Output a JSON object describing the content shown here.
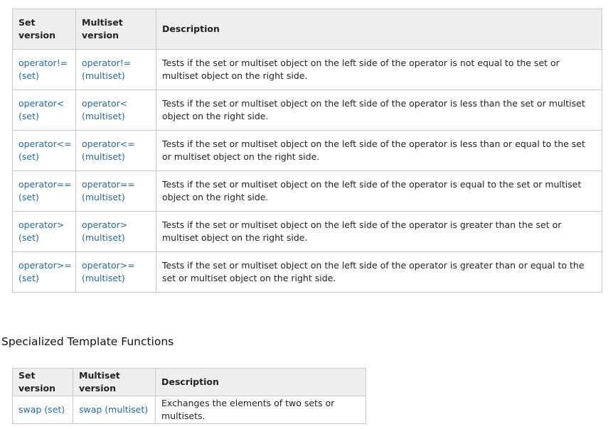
{
  "comparison_table": {
    "headers": [
      "Set version",
      "Multiset version",
      "Description"
    ],
    "rows": [
      {
        "set_l1": "operator!=",
        "set_l2": "(set)",
        "multi_l1": "operator!=",
        "multi_l2": "(multiset)",
        "description": "Tests if the set or multiset object on the left side of the operator is not equal to the set or multiset object on the right side."
      },
      {
        "set_l1": "operator<",
        "set_l2": "(set)",
        "multi_l1": "operator<",
        "multi_l2": "(multiset)",
        "description": "Tests if the set or multiset object on the left side of the operator is less than the set or multiset object on the right side."
      },
      {
        "set_l1": "operator<=",
        "set_l2": "(set)",
        "multi_l1": "operator<=",
        "multi_l2": "(multiset)",
        "description": "Tests if the set or multiset object on the left side of the operator is less than or equal to the set or multiset object on the right side."
      },
      {
        "set_l1": "operator==",
        "set_l2": "(set)",
        "multi_l1": "operator==",
        "multi_l2": "(multiset)",
        "description": "Tests if the set or multiset object on the left side of the operator is equal to the set or multiset object on the right side."
      },
      {
        "set_l1": "operator>",
        "set_l2": "(set)",
        "multi_l1": "operator>",
        "multi_l2": "(multiset)",
        "description": "Tests if the set or multiset object on the left side of the operator is greater than the set or multiset object on the right side."
      },
      {
        "set_l1": "operator>=",
        "set_l2": "(set)",
        "multi_l1": "operator>=",
        "multi_l2": "(multiset)",
        "description": "Tests if the set or multiset object on the left side of the operator is greater than or equal to the set or multiset object on the right side."
      }
    ]
  },
  "section_heading": "Specialized Template Functions",
  "template_table": {
    "headers": [
      "Set version",
      "Multiset version",
      "Description"
    ],
    "rows": [
      {
        "set_link": "swap (set)",
        "multi_link": "swap (multiset)",
        "description": "Exchanges the elements of two sets or multisets."
      }
    ]
  },
  "colors": {
    "link": "#1f6aa5",
    "header_bg": "#eeeeee",
    "border": "#c8c8c8"
  }
}
